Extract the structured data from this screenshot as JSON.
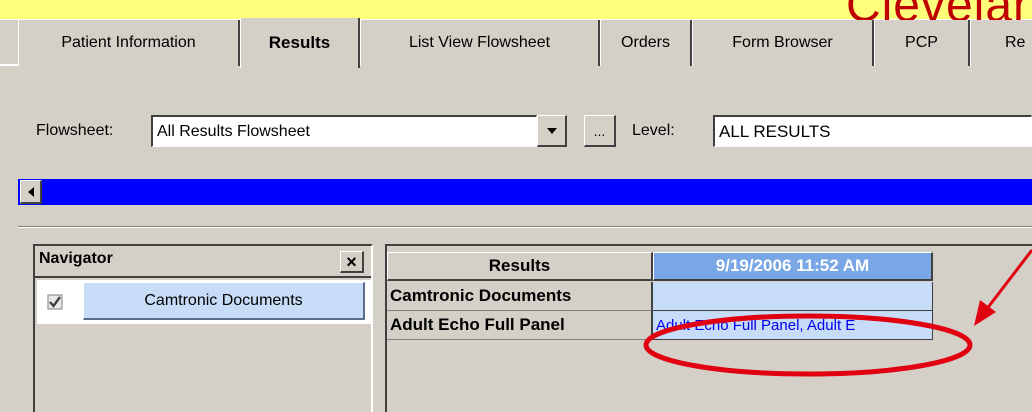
{
  "window": {
    "title_partial": "Clevelar"
  },
  "tabs": [
    {
      "label": "Patient Information",
      "active": false
    },
    {
      "label": "Results",
      "active": true
    },
    {
      "label": "List View Flowsheet",
      "active": false
    },
    {
      "label": "Orders",
      "active": false
    },
    {
      "label": "Form Browser",
      "active": false
    },
    {
      "label": "PCP",
      "active": false
    },
    {
      "label": "Re",
      "active": false
    }
  ],
  "flowsheet": {
    "label": "Flowsheet:",
    "value": "All Results Flowsheet",
    "browse_label": "...",
    "level_label": "Level:",
    "level_value": "ALL RESULTS"
  },
  "navigator": {
    "title": "Navigator",
    "close_label": "×",
    "items": [
      {
        "label": "Camtronic Documents",
        "checked": true
      }
    ]
  },
  "results_grid": {
    "header": "Results",
    "date_header": "9/19/2006 11:52 AM",
    "rows": [
      {
        "label": "Camtronic Documents",
        "value": ""
      },
      {
        "label": "Adult Echo Full Panel",
        "value": "Adult Echo Full Panel, Adult E"
      }
    ]
  },
  "colors": {
    "title_yellow": "#fffe7a",
    "title_red": "#c00000",
    "progress_blue": "#0000ff",
    "date_header_blue": "#79a7e6",
    "cell_light_blue": "#c6dcf7",
    "annotation_red": "#e00010"
  },
  "annotations": {
    "highlight": "red-ellipse-with-arrow"
  }
}
